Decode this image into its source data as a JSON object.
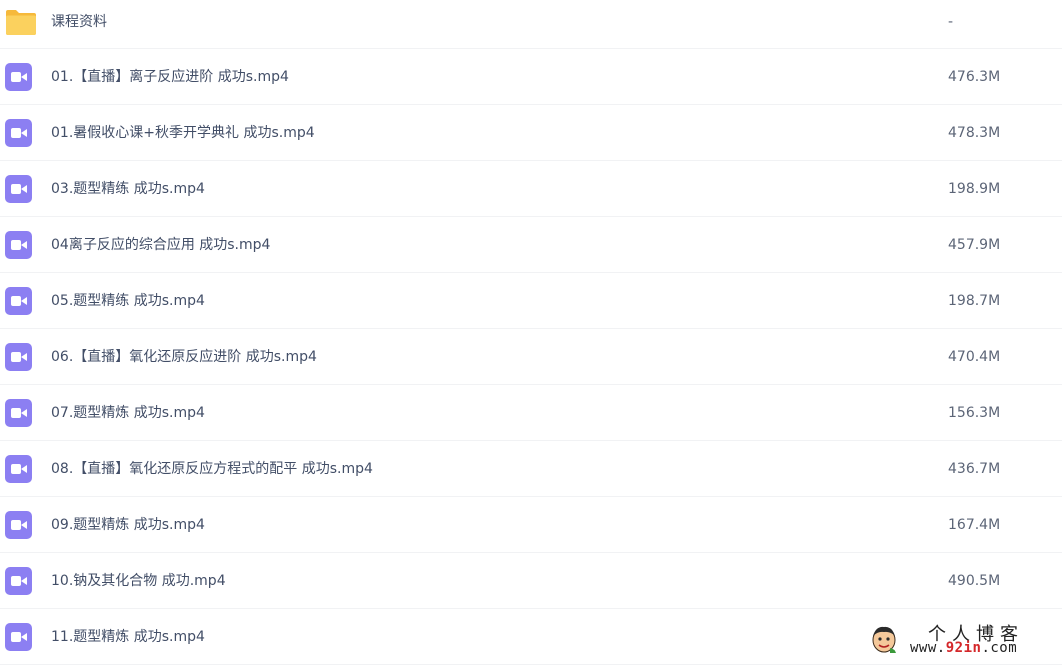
{
  "file_list": {
    "items": [
      {
        "type": "folder",
        "icon": "folder-icon",
        "name": "课程资料",
        "size": "-"
      },
      {
        "type": "video",
        "icon": "video-file-icon",
        "name": "01.【直播】离子反应进阶 成功s.mp4",
        "size": "476.3M"
      },
      {
        "type": "video",
        "icon": "video-file-icon",
        "name": "01.暑假收心课+秋季开学典礼 成功s.mp4",
        "size": "478.3M"
      },
      {
        "type": "video",
        "icon": "video-file-icon",
        "name": "03.题型精练 成功s.mp4",
        "size": "198.9M"
      },
      {
        "type": "video",
        "icon": "video-file-icon",
        "name": "04离子反应的综合应用 成功s.mp4",
        "size": "457.9M"
      },
      {
        "type": "video",
        "icon": "video-file-icon",
        "name": "05.题型精练 成功s.mp4",
        "size": "198.7M"
      },
      {
        "type": "video",
        "icon": "video-file-icon",
        "name": "06.【直播】氧化还原反应进阶 成功s.mp4",
        "size": "470.4M"
      },
      {
        "type": "video",
        "icon": "video-file-icon",
        "name": "07.题型精炼 成功s.mp4",
        "size": "156.3M"
      },
      {
        "type": "video",
        "icon": "video-file-icon",
        "name": "08.【直播】氧化还原反应方程式的配平 成功s.mp4",
        "size": "436.7M"
      },
      {
        "type": "video",
        "icon": "video-file-icon",
        "name": "09.题型精炼 成功s.mp4",
        "size": "167.4M"
      },
      {
        "type": "video",
        "icon": "video-file-icon",
        "name": "10.钠及其化合物 成功.mp4",
        "size": "490.5M"
      },
      {
        "type": "video",
        "icon": "video-file-icon",
        "name": "11.题型精炼 成功s.mp4",
        "size": ""
      }
    ]
  },
  "watermark": {
    "title": "个人博客",
    "url_prefix": "www.",
    "url_highlight": "92in",
    "url_suffix": ".com"
  },
  "colors": {
    "folder": "#f9c94d",
    "video_icon": "#8c7ff2",
    "row_divider": "#f1f2f4",
    "text": "#424e67"
  }
}
